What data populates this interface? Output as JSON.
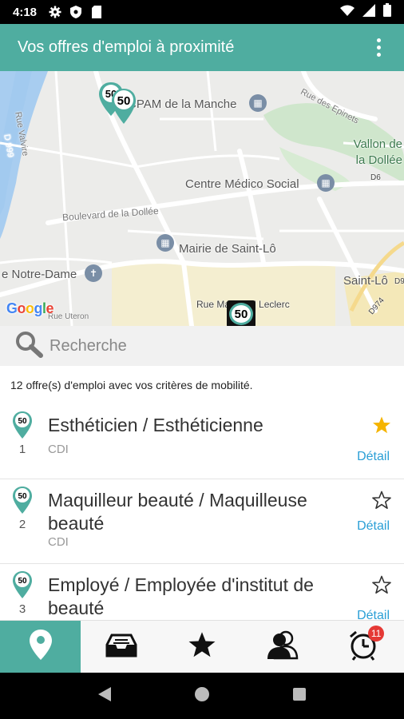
{
  "status_bar": {
    "time": "4:18"
  },
  "app_bar": {
    "title": "Vos offres d'emploi à proximité"
  },
  "map": {
    "labels": {
      "rue_valvire": "Rue Valvire",
      "d999": "D 999",
      "cpam": "CPAM de la Manche",
      "rue_epinets": "Rue des Epinets",
      "vallon": "Vallon de la Dollée",
      "d6": "D6",
      "centre_medico": "Centre Médico Social",
      "boulevard": "Boulevard de la Dollée",
      "mairie": "Mairie de Saint-Lô",
      "notre_dame": "e Notre-Dame",
      "saint_lo": "Saint-Lô",
      "d972": "D972",
      "rue_leclerc": "Rue Maréchal Leclerc",
      "d974": "D974",
      "rue_uteron": "Rue Uteron",
      "marker_label": "50"
    },
    "google": [
      "G",
      "o",
      "o",
      "g",
      "l",
      "e"
    ]
  },
  "search": {
    "placeholder": "Recherche"
  },
  "result_count": "12 offre(s) d'emploi avec vos critères de mobilité.",
  "jobs": [
    {
      "badge": "50",
      "rank": "1",
      "title": "Esthéticien / Esthéticienne",
      "contract": "CDI",
      "detail": "Détail",
      "favorite": true
    },
    {
      "badge": "50",
      "rank": "2",
      "title": "Maquilleur beauté / Maquilleuse beauté",
      "contract": "CDI",
      "detail": "Détail",
      "favorite": false
    },
    {
      "badge": "50",
      "rank": "3",
      "title": "Employé / Employée d'institut de beauté",
      "contract": "",
      "detail": "Détail",
      "favorite": false
    }
  ],
  "tabs": [
    {
      "icon": "location-pin-icon",
      "active": true
    },
    {
      "icon": "inbox-icon",
      "active": false
    },
    {
      "icon": "star-icon",
      "active": false
    },
    {
      "icon": "profile-icon",
      "active": false
    },
    {
      "icon": "alarm-clock-icon",
      "active": false,
      "badge": "11"
    }
  ],
  "colors": {
    "accent": "#4fada0",
    "link": "#2a9fd6",
    "favorite": "#f5b400",
    "badge": "#e53935"
  }
}
